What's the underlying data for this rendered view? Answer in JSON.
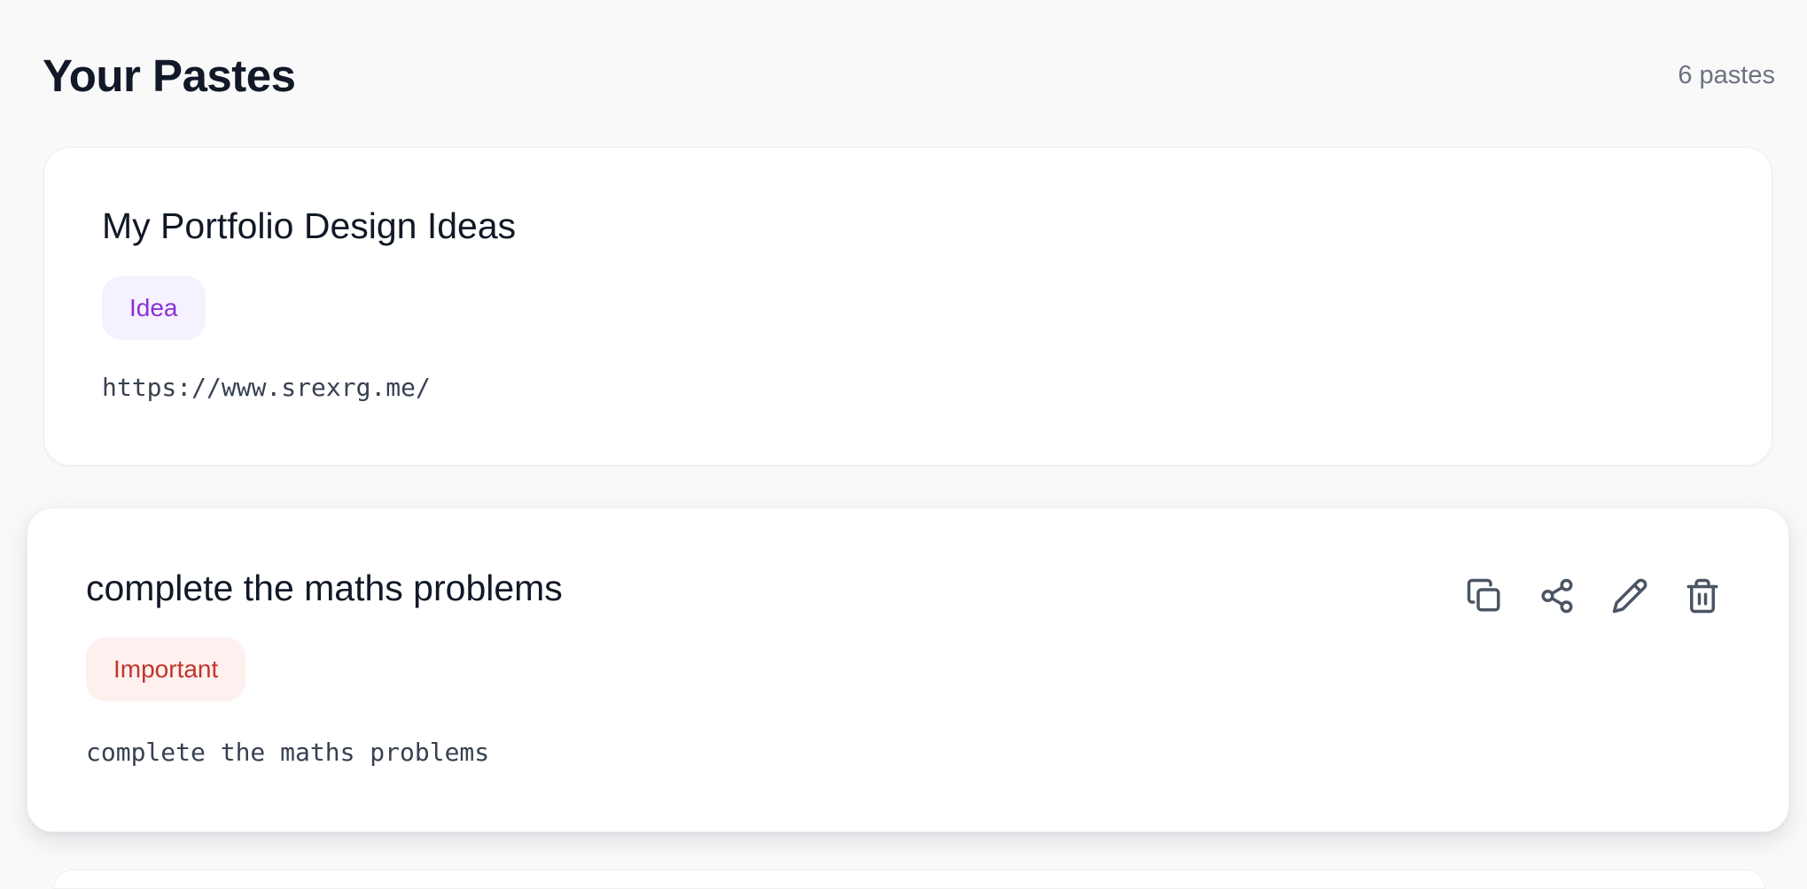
{
  "header": {
    "title": "Your Pastes",
    "count": "6 pastes"
  },
  "pastes": [
    {
      "title": "My Portfolio Design Ideas",
      "tag": "Idea",
      "tag_color": "#8a31d8",
      "tag_bg": "#f5f1fe",
      "content": "https://www.srexrg.me/"
    },
    {
      "title": "complete the maths problems",
      "tag": "Important",
      "tag_color": "#c2352a",
      "tag_bg": "#fdf0ef",
      "content": "complete the maths problems",
      "actions": [
        {
          "icon": "copy-icon"
        },
        {
          "icon": "share-icon"
        },
        {
          "icon": "edit-icon"
        },
        {
          "icon": "trash-icon"
        }
      ]
    }
  ],
  "colors": {
    "background": "#f9f9fa",
    "card": "#ffffff",
    "title": "#111827",
    "muted": "#6b7280",
    "icon": "#4b5563"
  }
}
